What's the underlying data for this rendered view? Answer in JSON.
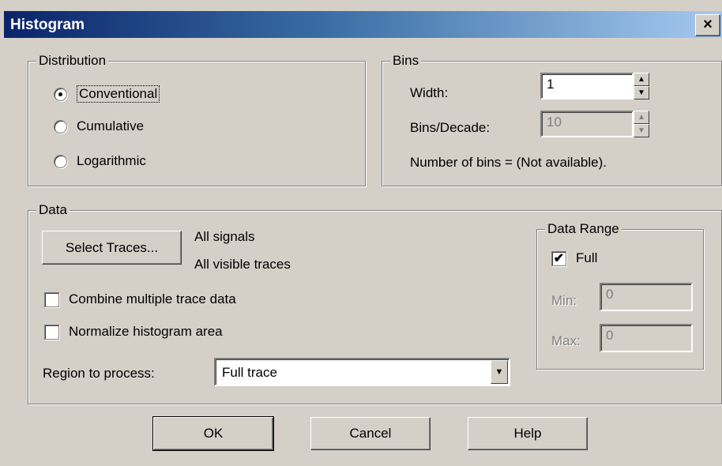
{
  "window": {
    "title": "Histogram",
    "close_symbol": "×"
  },
  "distribution": {
    "legend": "Distribution",
    "options": [
      {
        "label": "Conventional",
        "selected": true
      },
      {
        "label": "Cumulative",
        "selected": false
      },
      {
        "label": "Logarithmic",
        "selected": false
      }
    ]
  },
  "bins": {
    "legend": "Bins",
    "width_label": "Width:",
    "width_value": "1",
    "bins_decade_label": "Bins/Decade:",
    "bins_decade_value": "10",
    "number_of_bins_text": "Number of bins = (Not available)."
  },
  "data": {
    "legend": "Data",
    "select_traces_label": "Select Traces...",
    "signals_text": "All signals",
    "traces_text": "All visible traces",
    "combine_label": "Combine multiple trace data",
    "combine_checked": false,
    "normalize_label": "Normalize histogram area",
    "normalize_checked": false,
    "region_label": "Region to process:",
    "region_value": "Full trace"
  },
  "data_range": {
    "legend": "Data Range",
    "full_label": "Full",
    "full_checked": true,
    "min_label": "Min:",
    "min_value": "0",
    "max_label": "Max:",
    "max_value": "0"
  },
  "buttons": {
    "ok": "OK",
    "cancel": "Cancel",
    "help": "Help"
  },
  "icons": {
    "check_mark": "✔",
    "spin_up": "▲",
    "spin_down": "▼",
    "dropdown": "▼"
  }
}
